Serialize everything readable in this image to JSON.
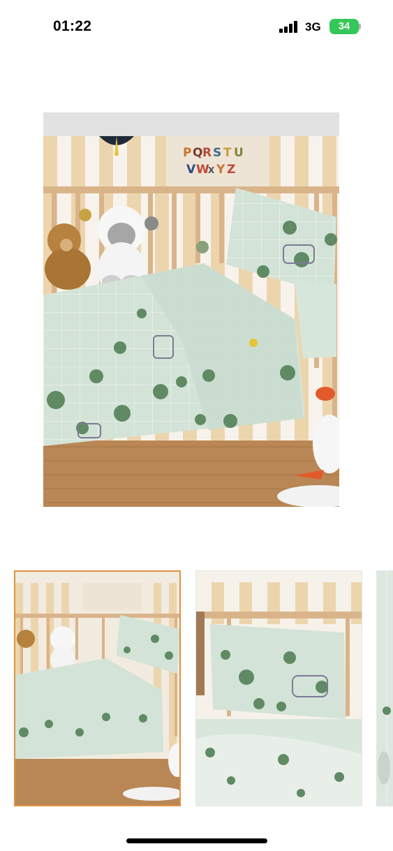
{
  "status_bar": {
    "time": "01:22",
    "network": "3G",
    "battery": "34"
  },
  "product_gallery": {
    "main_image": "crib-bedding-main-photo",
    "thumbnails": [
      {
        "image": "crib-bedding-thumbnail",
        "selected": true
      },
      {
        "image": "pillow-closeup-thumbnail",
        "selected": false
      },
      {
        "image": "fabric-detail-thumbnail",
        "selected": false
      }
    ]
  },
  "wall_banner_letters": [
    "P",
    "Q",
    "R",
    "S",
    "T",
    "U",
    "V",
    "W",
    "X",
    "Y",
    "Z"
  ],
  "colors": {
    "selected_border": "#e0913f",
    "bedding": "#cfe0d4",
    "tree": "#5f8a63",
    "crib_wood": "#d9b48a",
    "battery": "#34c759"
  }
}
